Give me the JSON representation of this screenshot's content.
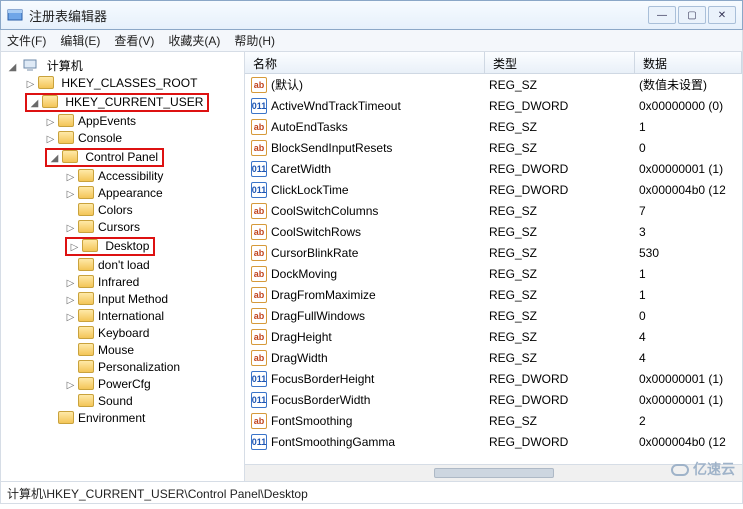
{
  "window": {
    "title": "注册表编辑器"
  },
  "menu": [
    "文件(F)",
    "编辑(E)",
    "查看(V)",
    "收藏夹(A)",
    "帮助(H)"
  ],
  "tree": {
    "root": "计算机",
    "hives": [
      {
        "label": "HKEY_CLASSES_ROOT",
        "exp": false
      },
      {
        "label": "HKEY_CURRENT_USER",
        "exp": true,
        "mark": true,
        "children": [
          {
            "label": "AppEvents"
          },
          {
            "label": "Console"
          },
          {
            "label": "Control Panel",
            "exp": true,
            "mark": true,
            "children": [
              {
                "label": "Accessibility"
              },
              {
                "label": "Appearance"
              },
              {
                "label": "Colors"
              },
              {
                "label": "Cursors"
              },
              {
                "label": "Desktop",
                "mark": true
              },
              {
                "label": "don't load"
              },
              {
                "label": "Infrared"
              },
              {
                "label": "Input Method"
              },
              {
                "label": "International"
              },
              {
                "label": "Keyboard"
              },
              {
                "label": "Mouse"
              },
              {
                "label": "Personalization"
              },
              {
                "label": "PowerCfg"
              },
              {
                "label": "Sound"
              }
            ]
          },
          {
            "label": "Environment"
          }
        ]
      }
    ]
  },
  "columns": {
    "name": "名称",
    "type": "类型",
    "data": "数据"
  },
  "values": [
    {
      "icon": "str",
      "name": "(默认)",
      "type": "REG_SZ",
      "data": "(数值未设置)"
    },
    {
      "icon": "bin",
      "name": "ActiveWndTrackTimeout",
      "type": "REG_DWORD",
      "data": "0x00000000 (0)"
    },
    {
      "icon": "str",
      "name": "AutoEndTasks",
      "type": "REG_SZ",
      "data": "1"
    },
    {
      "icon": "str",
      "name": "BlockSendInputResets",
      "type": "REG_SZ",
      "data": "0"
    },
    {
      "icon": "bin",
      "name": "CaretWidth",
      "type": "REG_DWORD",
      "data": "0x00000001 (1)"
    },
    {
      "icon": "bin",
      "name": "ClickLockTime",
      "type": "REG_DWORD",
      "data": "0x000004b0 (12"
    },
    {
      "icon": "str",
      "name": "CoolSwitchColumns",
      "type": "REG_SZ",
      "data": "7"
    },
    {
      "icon": "str",
      "name": "CoolSwitchRows",
      "type": "REG_SZ",
      "data": "3"
    },
    {
      "icon": "str",
      "name": "CursorBlinkRate",
      "type": "REG_SZ",
      "data": "530"
    },
    {
      "icon": "str",
      "name": "DockMoving",
      "type": "REG_SZ",
      "data": "1"
    },
    {
      "icon": "str",
      "name": "DragFromMaximize",
      "type": "REG_SZ",
      "data": "1"
    },
    {
      "icon": "str",
      "name": "DragFullWindows",
      "type": "REG_SZ",
      "data": "0"
    },
    {
      "icon": "str",
      "name": "DragHeight",
      "type": "REG_SZ",
      "data": "4"
    },
    {
      "icon": "str",
      "name": "DragWidth",
      "type": "REG_SZ",
      "data": "4"
    },
    {
      "icon": "bin",
      "name": "FocusBorderHeight",
      "type": "REG_DWORD",
      "data": "0x00000001 (1)"
    },
    {
      "icon": "bin",
      "name": "FocusBorderWidth",
      "type": "REG_DWORD",
      "data": "0x00000001 (1)"
    },
    {
      "icon": "str",
      "name": "FontSmoothing",
      "type": "REG_SZ",
      "data": "2"
    },
    {
      "icon": "bin",
      "name": "FontSmoothingGamma",
      "type": "REG_DWORD",
      "data": "0x000004b0 (12"
    }
  ],
  "status": "计算机\\HKEY_CURRENT_USER\\Control Panel\\Desktop",
  "watermark": "亿速云"
}
